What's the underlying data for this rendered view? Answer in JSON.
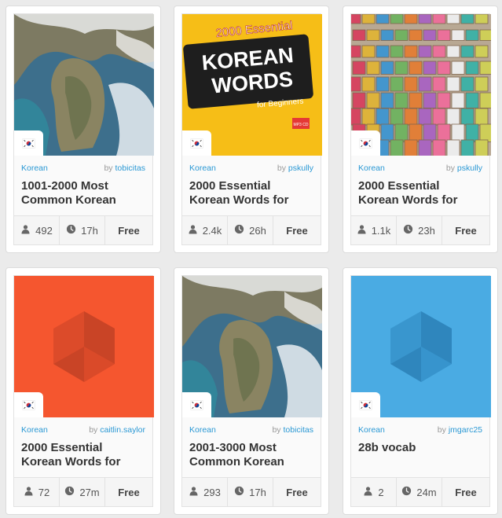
{
  "colors": {
    "accent": "#2a98d4",
    "orange_tile": "#f5562f",
    "blue_tile": "#4aabe3"
  },
  "courses": [
    {
      "thumb": "map",
      "flag_icon": "korea-flag-icon",
      "language": "Korean",
      "by": "by",
      "author": "tobicitas",
      "title": "1001-2000 Most Common Korean",
      "learners": "492",
      "time": "17h",
      "price": "Free"
    },
    {
      "thumb": "book-cover",
      "flag_icon": "korea-flag-icon",
      "language": "Korean",
      "by": "by",
      "author": "pskully",
      "title": "2000 Essential Korean Words for",
      "learners": "2.4k",
      "time": "26h",
      "price": "Free",
      "cover": {
        "top": "2000 Essential",
        "line1": "KOREAN",
        "line2": "WORDS",
        "line3": "for Beginners",
        "badge": "MP3 CD"
      }
    },
    {
      "thumb": "hangul-blocks",
      "flag_icon": "korea-flag-icon",
      "language": "Korean",
      "by": "by",
      "author": "pskully",
      "title": "2000 Essential Korean Words for",
      "learners": "1.1k",
      "time": "23h",
      "price": "Free"
    },
    {
      "thumb": "memrise-orange",
      "flag_icon": "korea-flag-icon",
      "language": "Korean",
      "by": "by",
      "author": "caitlin.saylor",
      "title": "2000 Essential Korean Words for",
      "learners": "72",
      "time": "27m",
      "price": "Free"
    },
    {
      "thumb": "map",
      "flag_icon": "korea-flag-icon",
      "language": "Korean",
      "by": "by",
      "author": "tobicitas",
      "title": "2001-3000 Most Common Korean",
      "learners": "293",
      "time": "17h",
      "price": "Free"
    },
    {
      "thumb": "memrise-blue",
      "flag_icon": "korea-flag-icon",
      "language": "Korean",
      "by": "by",
      "author": "jmgarc25",
      "title": "28b vocab",
      "learners": "2",
      "time": "24m",
      "price": "Free"
    }
  ]
}
